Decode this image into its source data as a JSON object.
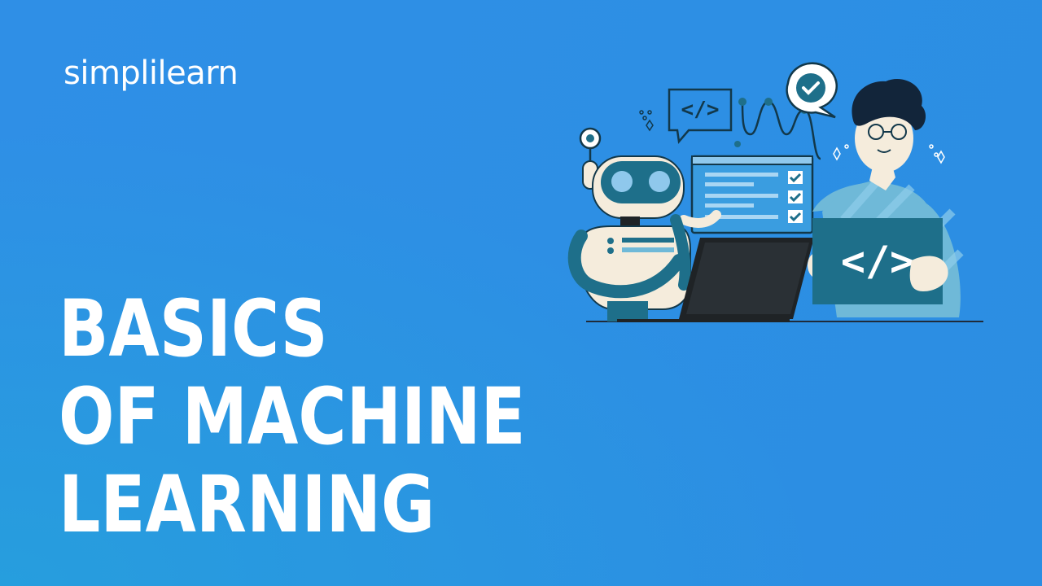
{
  "brand": {
    "logo_text": "simplilearn"
  },
  "headline": {
    "lines": [
      "BASICS",
      "OF MACHINE",
      "LEARNING"
    ]
  },
  "illustration": {
    "bubble_code_text": "</>",
    "card_code_text": "</>"
  },
  "colors": {
    "background": "#2d8fe4",
    "text": "#ffffff",
    "teal_dark": "#1e6f8a",
    "teal_light": "#6fb9d8",
    "skin": "#f5ecdc",
    "laptop": "#1f2326"
  }
}
